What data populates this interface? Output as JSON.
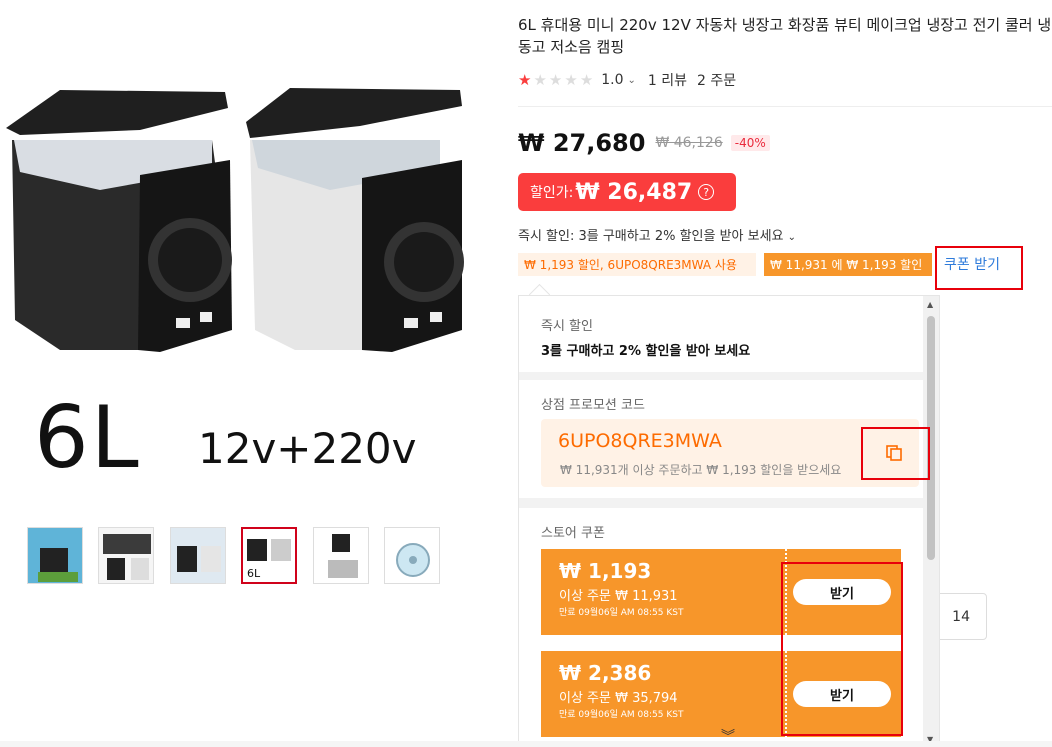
{
  "product": {
    "title": "6L 휴대용 미니 220v 12V 자동차 냉장고 화장품 뷰티 메이크업 냉장고 전기 쿨러 냉동고 저소음 캠핑",
    "image_text": {
      "size": "6L",
      "voltage": "12v+220v"
    },
    "thumbnails": [
      "thumb-1",
      "thumb-2",
      "thumb-3",
      "thumb-4",
      "thumb-5",
      "thumb-6"
    ],
    "selected_thumbnail": 4
  },
  "rating": {
    "value": "1.0",
    "stars": 1,
    "stars_total": 5,
    "reviews": "1 리뷰",
    "orders": "2 주문"
  },
  "price": {
    "current": "₩ 27,680",
    "original": "₩ 46,126",
    "discount": "-40%",
    "sale_label": "할인가:",
    "sale_price": "₩ 26,487"
  },
  "instant_discount_line": "즉시 할인: 3를 구매하고 2% 할인을 받아 보세요",
  "coupon_chips": [
    "₩ 1,193 할인, 6UPO8QRE3MWA 사용",
    "₩ 11,931 에 ₩ 1,193 할인"
  ],
  "get_coupon_link": "쿠폰 받기",
  "popup": {
    "instant": {
      "heading": "즉시 할인",
      "text": "3를 구매하고 2% 할인을 받아 보세요"
    },
    "promo": {
      "heading": "상점 프로모션 코드",
      "code": "6UPO8QRE3MWA",
      "desc": "₩ 11,931개 이상 주문하고 ₩ 1,193 할인을 받으세요"
    },
    "store_coupons": {
      "heading": "스토어 쿠폰",
      "items": [
        {
          "amount": "₩ 1,193",
          "condition": "이상 주문 ₩ 11,931",
          "expires": "만료 09월06일 AM 08:55 KST",
          "button": "받기"
        },
        {
          "amount": "₩ 2,386",
          "condition": "이상 주문 ₩ 35,794",
          "expires": "만료 09월06일 AM 08:55 KST",
          "button": "받기"
        }
      ]
    }
  },
  "side_button_count": "14",
  "colors": {
    "accent_red": "#fa3d3d",
    "orange": "#f7962a",
    "orange_text": "#fd6b00",
    "link_blue": "#2e7bdb",
    "highlight_box": "#e8000b"
  }
}
